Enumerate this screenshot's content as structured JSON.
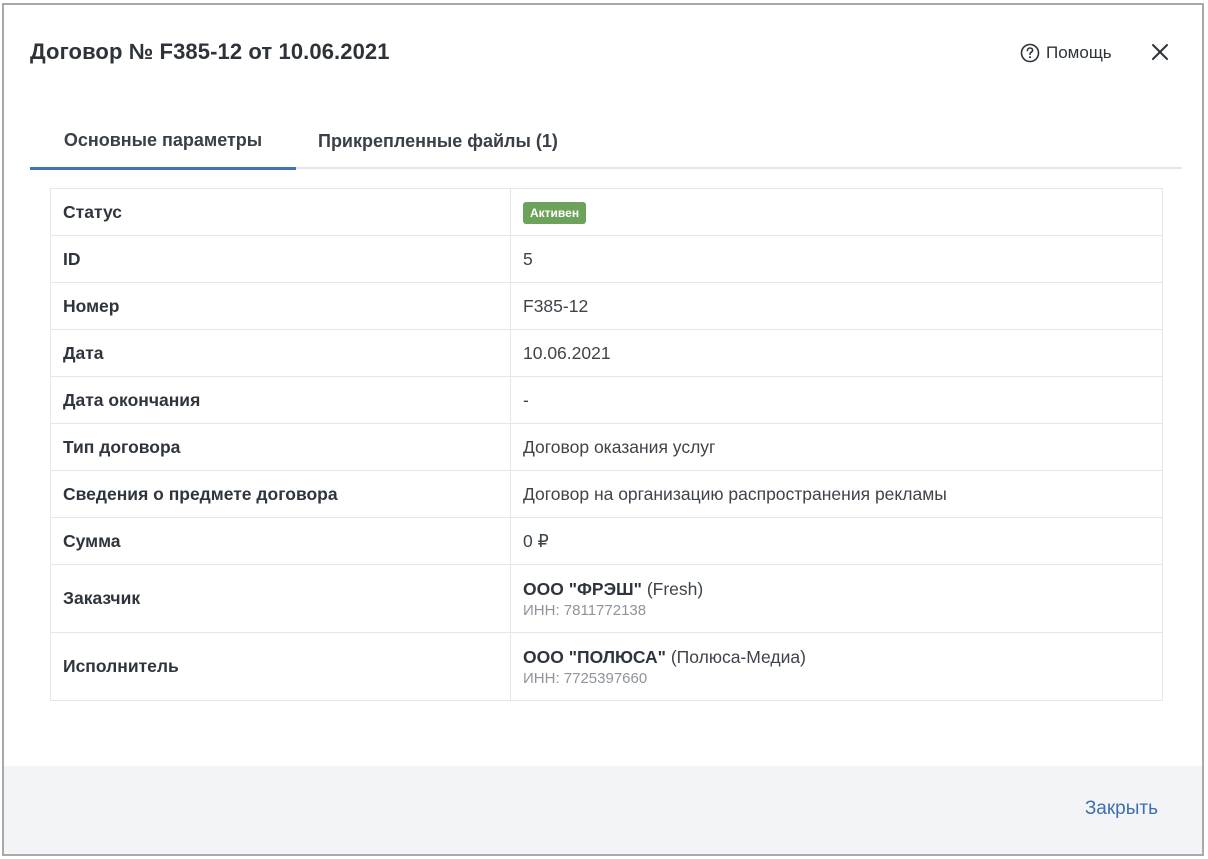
{
  "dialog": {
    "title": "Договор № F385-12 от 10.06.2021",
    "help_label": "Помощь",
    "close_label": "Закрыть"
  },
  "tabs": [
    {
      "label": "Основные параметры",
      "active": true
    },
    {
      "label": "Прикрепленные файлы (1)",
      "active": false
    }
  ],
  "params": {
    "status": {
      "label": "Статус",
      "value": "Активен",
      "color": "#6ca25a"
    },
    "id": {
      "label": "ID",
      "value": "5"
    },
    "number": {
      "label": "Номер",
      "value": "F385-12"
    },
    "date": {
      "label": "Дата",
      "value": "10.06.2021"
    },
    "end_date": {
      "label": "Дата окончания",
      "value": "-"
    },
    "type": {
      "label": "Тип договора",
      "value": "Договор оказания услуг"
    },
    "subject": {
      "label": "Сведения о предмете договора",
      "value": "Договор на организацию распространения рекламы"
    },
    "amount": {
      "label": "Сумма",
      "value": "0 ₽"
    },
    "customer": {
      "label": "Заказчик",
      "name": "ООО \"ФРЭШ\"",
      "alias": "(Fresh)",
      "inn": "ИНН: 7811772138"
    },
    "contractor": {
      "label": "Исполнитель",
      "name": "ООО \"ПОЛЮСА\"",
      "alias": "(Полюса-Медиа)",
      "inn": "ИНН: 7725397660"
    }
  },
  "colors": {
    "accent": "#3c73b9",
    "footer_bg": "#f3f4f7"
  }
}
